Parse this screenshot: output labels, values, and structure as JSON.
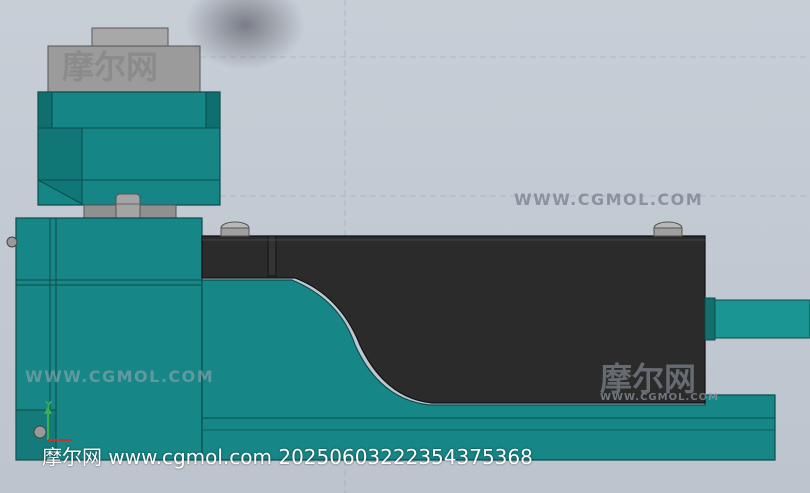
{
  "watermarks": {
    "site_top": "WWW.CGMOL.COM",
    "site_left": "WWW.CGMOL.COM",
    "logo_cn": "摩尔网",
    "logo_cn_top": "摩尔网",
    "logo_en": "WWW.CGMOL.COM"
  },
  "caption": "摩尔网 www.cgmol.com 20250603222354375368",
  "axis": {
    "y_label": "Y"
  },
  "colors": {
    "background": "#c4cbd4",
    "teal_body": "#178a8a",
    "teal_dark": "#0f6a6a",
    "black_cover": "#2a2a2a",
    "metal_gray": "#9a9a9a"
  }
}
